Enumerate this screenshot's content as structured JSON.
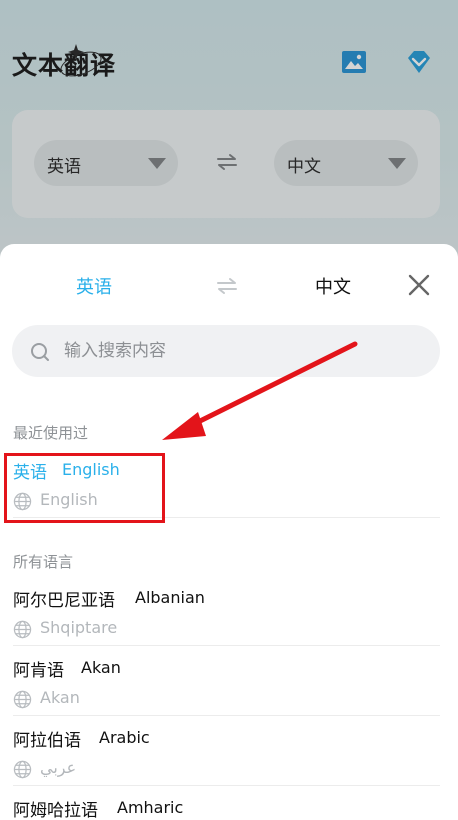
{
  "app": {
    "title": "文本翻译",
    "source_lang": "英语",
    "target_lang": "中文"
  },
  "sheet": {
    "source_tab": "英语",
    "target_tab": "中文",
    "search_placeholder": "输入搜索内容",
    "recent_label": "最近使用过",
    "all_label": "所有语言",
    "recent": [
      {
        "zh": "英语",
        "en": "English",
        "endonym": "English"
      }
    ],
    "languages": [
      {
        "zh": "阿尔巴尼亚语",
        "en": "Albanian",
        "endonym": "Shqiptare"
      },
      {
        "zh": "阿肯语",
        "en": "Akan",
        "endonym": "Akan"
      },
      {
        "zh": "阿拉伯语",
        "en": "Arabic",
        "endonym": "عربي"
      },
      {
        "zh": "阿姆哈拉语",
        "en": "Amharic",
        "endonym": ""
      }
    ]
  },
  "colors": {
    "accent": "#2ab0ea",
    "annotation": "#e3141a"
  },
  "icons": [
    "image-icon",
    "vip-diamond-icon",
    "swap-icon",
    "close-icon",
    "search-icon",
    "globe-icon"
  ]
}
